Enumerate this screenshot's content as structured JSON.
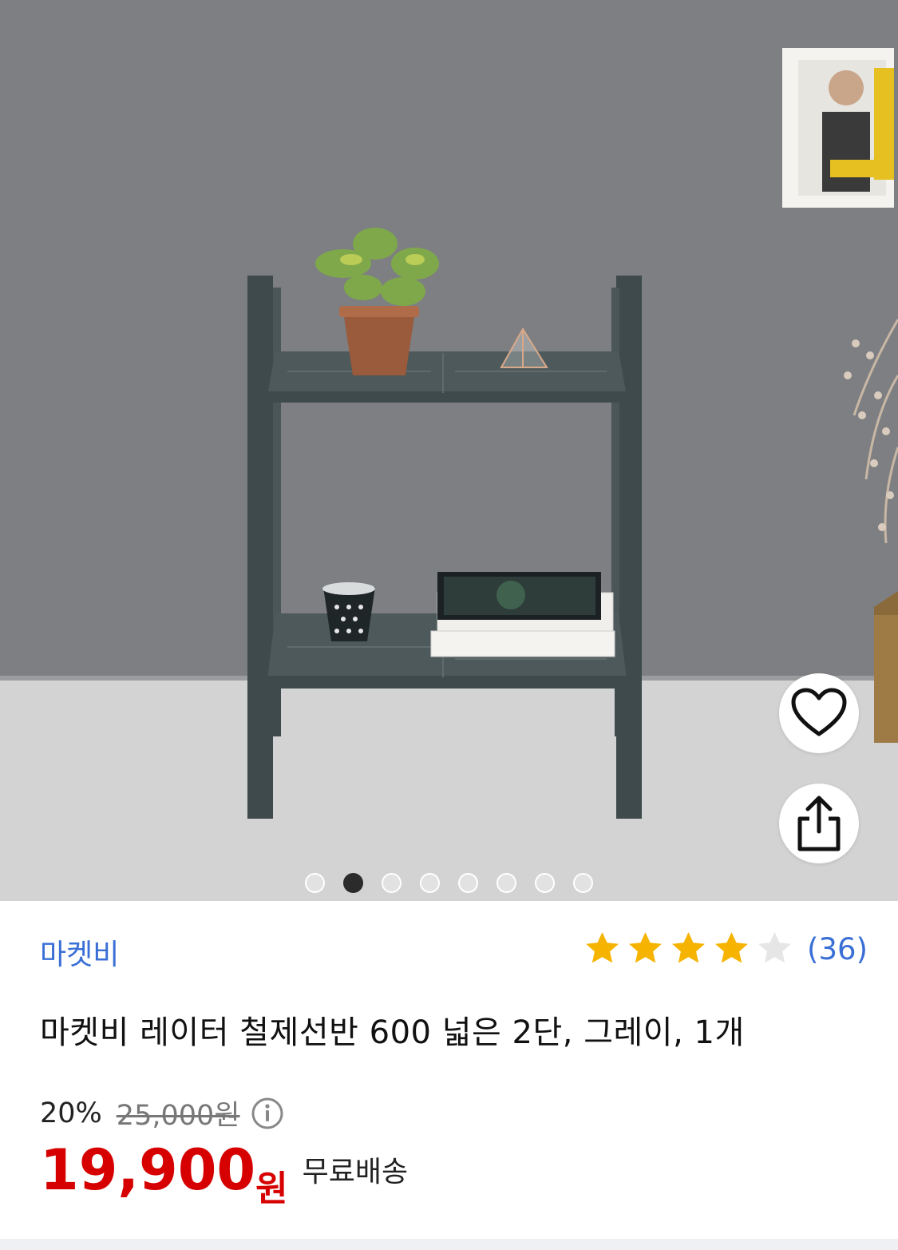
{
  "product": {
    "brand": "마켓비",
    "title": "마켓비 레이터 철제선반 600 넓은 2단, 그레이, 1개",
    "rating_stars": 4,
    "rating_max": 5,
    "review_count": "(36)",
    "discount": "20%",
    "original_price": "25,000원",
    "sale_price": "19,900",
    "currency": "원",
    "shipping": "무료배송"
  },
  "gallery": {
    "current_index": 2,
    "total": 8
  },
  "colors": {
    "accent_blue": "#3a6fd6",
    "price_red": "#d60000",
    "star_gold": "#f6b400",
    "star_empty": "#e6e6e6"
  }
}
